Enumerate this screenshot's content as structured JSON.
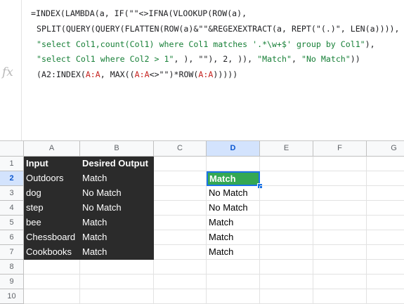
{
  "formula_bar": {
    "fx_label": "fx",
    "lines": [
      [
        {
          "t": "=INDEX(LAMBDA(a, IF(\"\"<>IFNA(VLOOKUP(ROW(a),",
          "c": ""
        }
      ],
      [
        {
          "t": "SPLIT(QUERY(QUERY(FLATTEN(ROW(a)&\"\"&REGEXEXTRACT(a, REPT(\"(.)\", LEN(a)))),",
          "c": ""
        }
      ],
      [
        {
          "t": "\"select Col1,count(Col1) where Col1 matches '.*\\w+$' group by Col1\"",
          "c": "str"
        },
        {
          "t": "),",
          "c": ""
        }
      ],
      [
        {
          "t": "\"select Col1 where Col2 > 1\"",
          "c": "str"
        },
        {
          "t": ", ), \"\"), 2, )), ",
          "c": ""
        },
        {
          "t": "\"Match\"",
          "c": "str"
        },
        {
          "t": ", ",
          "c": ""
        },
        {
          "t": "\"No Match\"",
          "c": "str"
        },
        {
          "t": "))",
          "c": ""
        }
      ],
      [
        {
          "t": "(A2:INDEX(",
          "c": ""
        },
        {
          "t": "A:A",
          "c": "ref"
        },
        {
          "t": ", MAX((",
          "c": ""
        },
        {
          "t": "A:A",
          "c": "ref"
        },
        {
          "t": "<>\"\")*ROW(",
          "c": ""
        },
        {
          "t": "A:A",
          "c": "ref"
        },
        {
          "t": ")))))",
          "c": ""
        }
      ]
    ]
  },
  "sheet": {
    "columns": [
      "A",
      "B",
      "C",
      "D",
      "E",
      "F",
      "G"
    ],
    "rows": [
      "1",
      "2",
      "3",
      "4",
      "5",
      "6",
      "7",
      "8",
      "9",
      "10"
    ],
    "cells": {
      "A1": "Input",
      "B1": "Desired Output",
      "A2": "Outdoors",
      "B2": "Match",
      "A3": "dog",
      "B3": "No Match",
      "A4": "step",
      "B4": "No Match",
      "A5": "bee",
      "B5": "Match",
      "A6": "Chessboard",
      "B6": "Match",
      "A7": "Cookbooks",
      "B7": "Match",
      "D2": "Match",
      "D3": "No Match",
      "D4": "No Match",
      "D5": "Match",
      "D6": "Match",
      "D7": "Match"
    },
    "active_cell": "D2",
    "colors": {
      "dark_fill": "#2b2b2b",
      "active_fill": "#34a853",
      "selection": "#1a73e8",
      "string": "#188038",
      "range": "#c5221f"
    }
  }
}
